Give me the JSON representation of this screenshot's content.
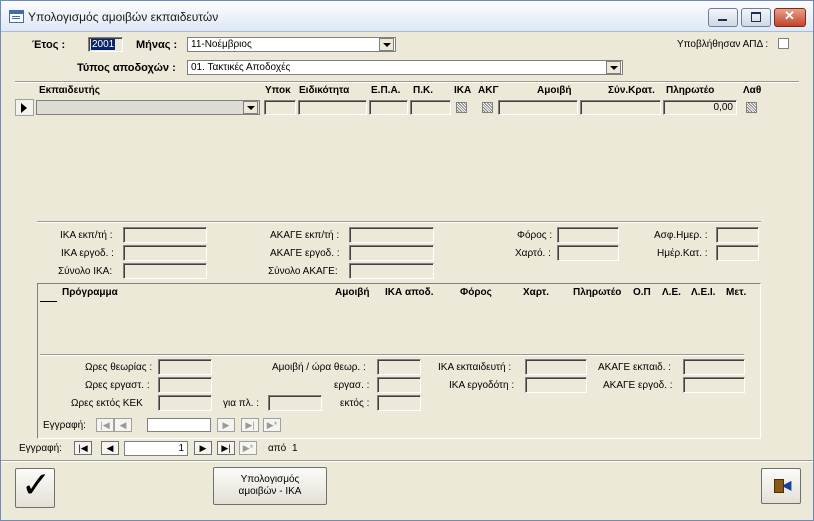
{
  "window": {
    "title": "Υπολογισμός αμοιβών εκπαιδευτών"
  },
  "header": {
    "year_label": "Έτος :",
    "year_value": "2001",
    "month_label": "Μήνας :",
    "month_value": "11-Νοέμβριος",
    "apd_label": "Υποβλήθησαν ΑΠΔ :",
    "pay_type_label": "Τύπος αποδοχών :",
    "pay_type_value": "01. Τακτικές Αποδοχές"
  },
  "grid": {
    "columns": [
      "Εκπαιδευτής",
      "Υποκ",
      "Ειδικότητα",
      "Ε.Π.Α.",
      "Π.Κ.",
      "ΙΚΑ",
      "ΑΚΓ",
      "Αμοιβή",
      "Σύν.Κρατ.",
      "Πληρωτέο",
      "Λαθ"
    ],
    "row": {
      "payable": "0,00"
    }
  },
  "totals": {
    "ika_emp": "ΙΚΑ εκπ/τή :",
    "ika_employer": "ΙΚΑ εργοδ. :",
    "ika_total": "Σύνολο ΙΚΑ:",
    "akage_emp": "ΑΚΑΓΕ εκπ/τή :",
    "akage_employer": "ΑΚΑΓΕ εργοδ. :",
    "akage_total": "Σύνολο ΑΚΑΓΕ:",
    "tax": "Φόρος :",
    "stamp": "Χαρτό. :",
    "ins_days": "Ασφ.Ημερ. :",
    "cat_days": "Ημέρ.Κατ. :"
  },
  "program_grid": {
    "columns": [
      "Πρόγραμμα",
      "Αμοιβή",
      "ΙΚΑ αποδ.",
      "Φόρος",
      "Χαρτ.",
      "Πληρωτέο",
      "Ο.Π",
      "Λ.Ε.",
      "Λ.Ε.Ι.",
      "Μετ."
    ]
  },
  "hours": {
    "theory": "Ωρες θεωρίας :",
    "lab": "Ωρες εργαστ. :",
    "outside_kek": "Ωρες εκτός ΚΕΚ",
    "for_pl": "για πλ. :",
    "fee_theory": "Αμοιβή / ώρα θεωρ. :",
    "lab_fee": "εργασ. :",
    "outside": "εκτός :",
    "ika_trainer": "ΙΚΑ εκπαιδευτή :",
    "ika_employer": "ΙΚΑ εργοδότη :",
    "akage_trainer": "ΑΚΑΓΕ εκπαιδ. :",
    "akage_employer": "ΑΚΑΓΕ εργοδ. :"
  },
  "subnav": {
    "label": "Εγγραφή:"
  },
  "nav": {
    "label": "Εγγραφή:",
    "current": "1",
    "of_label": "από",
    "total": "1"
  },
  "footer": {
    "calc_button": "Υπολογισμός αμοιβών - ΙΚΑ"
  },
  "icons": {
    "ok": "checkmark-icon",
    "exit": "exit-door-icon",
    "app": "form-icon"
  },
  "colors": {
    "window_bg": "#ece9d8",
    "selection": "#0a246a"
  }
}
